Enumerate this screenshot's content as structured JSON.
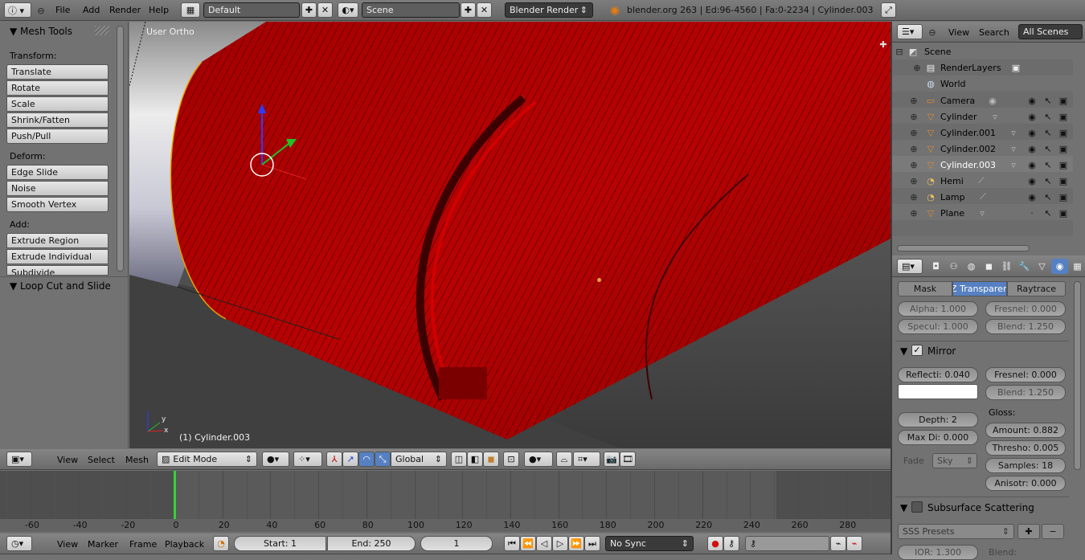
{
  "top": {
    "menus": [
      "File",
      "Add",
      "Render",
      "Help"
    ],
    "layout": "Default",
    "scene": "Scene",
    "engine": "Blender Render",
    "info": "blender.org 263 | Ed:96-4560 | Fa:0-2234 | Cylinder.003"
  },
  "toolshelf": {
    "title": "Mesh Tools",
    "transform_label": "Transform:",
    "transform": [
      "Translate",
      "Rotate",
      "Scale",
      "Shrink/Fatten",
      "Push/Pull"
    ],
    "deform_label": "Deform:",
    "deform": [
      "Edge Slide",
      "Noise",
      "Smooth Vertex"
    ],
    "add_label": "Add:",
    "add": [
      "Extrude Region",
      "Extrude Individual",
      "Subdivide"
    ],
    "loop_panel": "Loop Cut and Slide"
  },
  "viewport": {
    "view_label": "User Ortho",
    "object_label": "(1) Cylinder.003",
    "object_color": "#b30000"
  },
  "viewheader": {
    "menus": [
      "View",
      "Select",
      "Mesh"
    ],
    "mode": "Edit Mode",
    "orientation": "Global"
  },
  "timeline": {
    "ticks": [
      "-60",
      "-40",
      "-20",
      "0",
      "20",
      "40",
      "60",
      "80",
      "100",
      "120",
      "140",
      "160",
      "180",
      "200",
      "220",
      "240",
      "260",
      "280"
    ],
    "current_frame_tick": "0"
  },
  "timeheader": {
    "menus": [
      "View",
      "Marker",
      "Frame",
      "Playback"
    ],
    "start": "Start: 1",
    "end": "End: 250",
    "current": "1",
    "sync": "No Sync"
  },
  "outliner": {
    "menus": [
      "View",
      "Search"
    ],
    "filter": "All Scenes",
    "scene": "Scene",
    "render_layers": "RenderLayers",
    "world": "World",
    "objects": [
      {
        "name": "Camera",
        "icon": "camera-icon"
      },
      {
        "name": "Cylinder",
        "icon": "mesh-icon"
      },
      {
        "name": "Cylinder.001",
        "icon": "mesh-icon"
      },
      {
        "name": "Cylinder.002",
        "icon": "mesh-icon"
      },
      {
        "name": "Cylinder.003",
        "icon": "mesh-icon"
      },
      {
        "name": "Hemi",
        "icon": "lamp-icon"
      },
      {
        "name": "Lamp",
        "icon": "lamp-icon"
      },
      {
        "name": "Plane",
        "icon": "mesh-icon"
      }
    ]
  },
  "properties": {
    "tabs": [
      "Mask",
      "Z Transparen",
      "Raytrace"
    ],
    "alpha": "Alpha: 1.000",
    "fresnel_top": "Fresnel: 0.000",
    "specul": "Specul: 1.000",
    "blend_top": "Blend: 1.250",
    "mirror_title": "Mirror",
    "reflect": "Reflecti: 0.040",
    "fresnel_mirror": "Fresnel: 0.000",
    "blend_mirror": "Blend: 1.250",
    "depth": "Depth: 2",
    "gloss_label": "Gloss:",
    "amount": "Amount: 0.882",
    "max_dist": "Max Di: 0.000",
    "thresh": "Thresho: 0.005",
    "fade_label": "Fade",
    "fade_value": "Sky",
    "samples": "Samples: 18",
    "anisotr": "Anisotr: 0.000",
    "sss_title": "Subsurface Scattering",
    "sss_presets": "SSS Presets",
    "ior": "IOR: 1.300",
    "blend_sss": "Blend:"
  }
}
